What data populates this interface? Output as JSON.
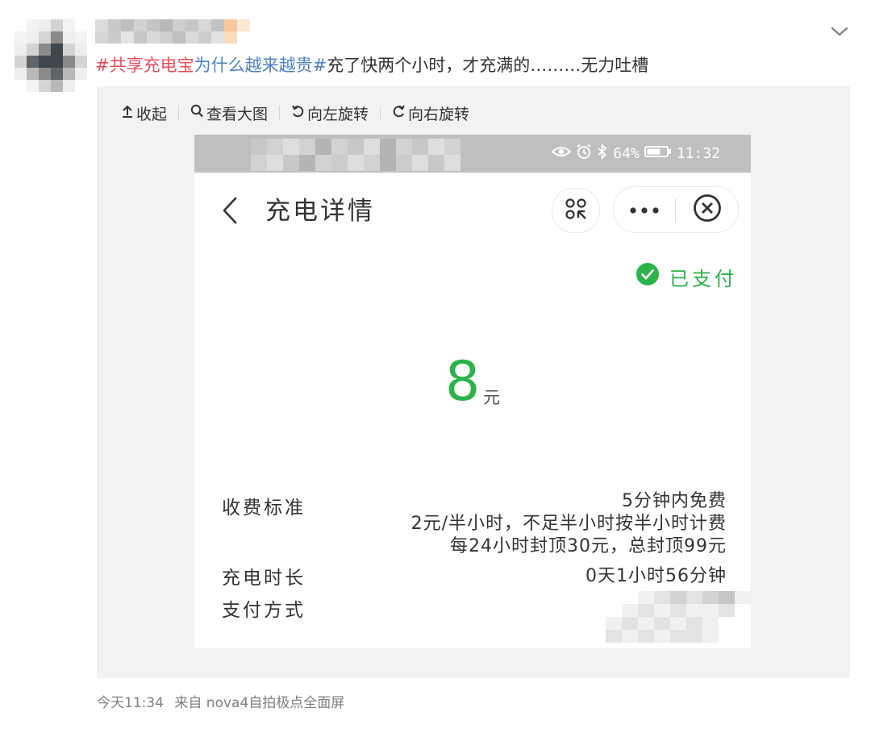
{
  "post": {
    "hashtag_prefix": "#",
    "hashtag_red": "共享充电宝",
    "hashtag_blue": "为什么越来越贵",
    "hashtag_suffix": "#",
    "body": "充了快两个小时，才充满的………无力吐槽"
  },
  "toolbar": {
    "collapse": "收起",
    "view_large": "查看大图",
    "rotate_left": "向左旋转",
    "rotate_right": "向右旋转"
  },
  "phone": {
    "status": {
      "battery": "64%",
      "time": "11:32"
    },
    "nav_title": "充电详情",
    "paid_badge": "已支付",
    "amount": "8",
    "amount_unit": "元",
    "details": {
      "fee_label": "收费标准",
      "fee_lines": [
        "5分钟内免费",
        "2元/半小时，不足半小时按半小时计费",
        "每24小时封顶30元，总封顶99元"
      ],
      "duration_label": "充电时长",
      "duration_value": "0天1小时56分钟",
      "payment_label": "支付方式"
    }
  },
  "footer": {
    "time": "今天11:34",
    "source": "来自 nova4自拍极点全面屏"
  },
  "colors": {
    "accent_green": "#2bb34b",
    "hashtag_red": "#eb4c5a",
    "hashtag_blue": "#4f83c4",
    "status_bar": "#bfbfbf",
    "media_bg": "#f2f2f2"
  },
  "icons": [
    "chevron-down-icon",
    "collapse-icon",
    "magnify-icon",
    "rotate-left-icon",
    "rotate-right-icon",
    "back-icon",
    "scan-icon",
    "more-icon",
    "close-circle-icon",
    "check-circle-icon",
    "eye-icon",
    "alarm-icon",
    "bluetooth-icon",
    "battery-icon"
  ]
}
